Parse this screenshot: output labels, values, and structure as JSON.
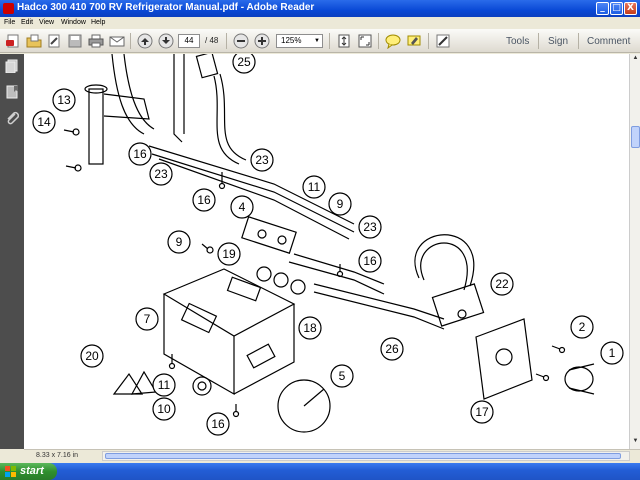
{
  "window": {
    "title": "Hadco 300 410 700 RV Refrigerator Manual.pdf - Adobe Reader",
    "buttons": {
      "minimize": "_",
      "maximize": "□",
      "close": "X"
    }
  },
  "menu": [
    "File",
    "Edit",
    "View",
    "Window",
    "Help"
  ],
  "toolbar": {
    "current_page": "44",
    "page_count": "/ 48",
    "zoom": "125%",
    "links": {
      "tools": "Tools",
      "sign": "Sign",
      "comment": "Comment"
    }
  },
  "status": {
    "page_size": "8.33 x 7.16 in"
  },
  "taskbar": {
    "start_label": "start"
  },
  "diagram": {
    "callouts": [
      "25",
      "13",
      "14",
      "16",
      "23",
      "23",
      "11",
      "9",
      "16",
      "4",
      "9",
      "19",
      "23",
      "16",
      "22",
      "7",
      "18",
      "2",
      "26",
      "20",
      "11",
      "1",
      "5",
      "10",
      "17",
      "16"
    ]
  },
  "colors": {
    "titlebar": "#0a49d6",
    "taskbar": "#235ed6",
    "start": "#2f8f2f",
    "nav": "#4d4d4d"
  }
}
